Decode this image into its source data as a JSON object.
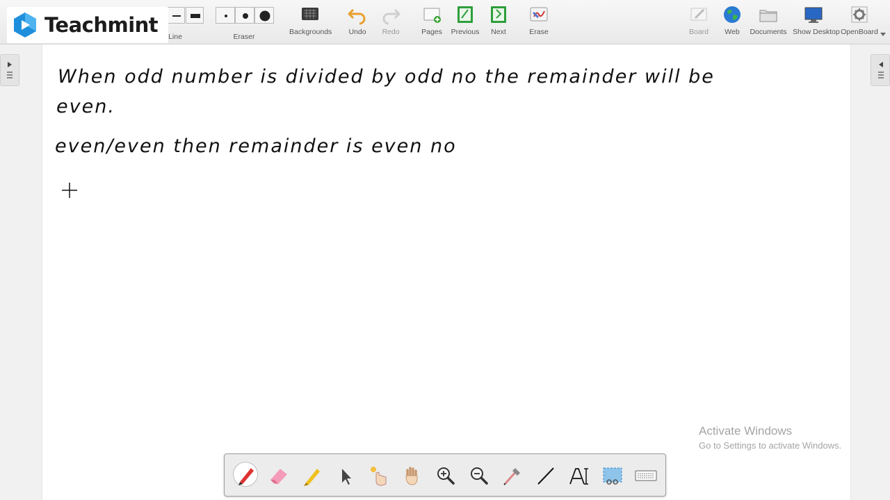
{
  "logo": {
    "text": "Teachmint"
  },
  "toolbar": {
    "line_label": "Line",
    "eraser_label": "Eraser",
    "backgrounds_label": "Backgrounds",
    "undo_label": "Undo",
    "redo_label": "Redo",
    "pages_label": "Pages",
    "previous_label": "Previous",
    "next_label": "Next",
    "erase_label": "Erase",
    "board_label": "Board",
    "web_label": "Web",
    "documents_label": "Documents",
    "show_desktop_label": "Show Desktop",
    "openboard_label": "OpenBoard"
  },
  "board": {
    "handwriting": [
      "When odd number is divided by odd no the remainder will be",
      "even.",
      "even/even then remainder is even no"
    ]
  },
  "watermark": {
    "title": "Activate Windows",
    "subtitle": "Go to Settings to activate Windows."
  },
  "bottom_tools": [
    "pen-icon",
    "eraser-icon",
    "marker-icon",
    "pointer-icon",
    "laser-icon",
    "hand-icon",
    "zoom-in-icon",
    "zoom-out-icon",
    "color-picker-icon",
    "line-icon",
    "text-icon",
    "capture-icon",
    "keyboard-icon"
  ],
  "colors": {
    "ink": "#111111",
    "accent_blue": "#1a7fd0",
    "toolbar_bg": "#ececec"
  }
}
